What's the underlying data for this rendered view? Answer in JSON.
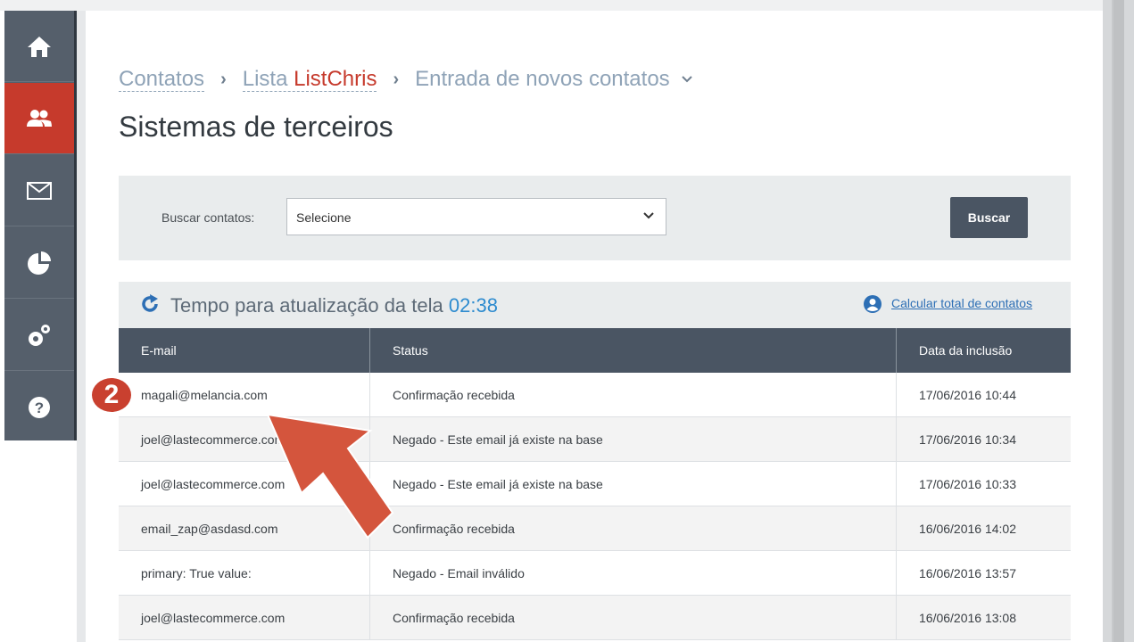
{
  "breadcrumb": {
    "contacts": "Contatos",
    "list_prefix": "Lista",
    "list_name": "ListChris",
    "current": "Entrada de novos contatos",
    "separator": "›",
    "chevron": "⌄"
  },
  "page_title": "Sistemas de terceiros",
  "search": {
    "label": "Buscar contatos:",
    "select_value": "Selecione",
    "button_label": "Buscar"
  },
  "results": {
    "timer_label": "Tempo para atualização da tela",
    "timer_value": "02:38",
    "calc_link": "Calcular total de contatos"
  },
  "table": {
    "headers": [
      "E-mail",
      "Status",
      "Data da inclusão"
    ],
    "rows": [
      [
        "magali@melancia.com",
        "Confirmação recebida",
        "17/06/2016 10:44"
      ],
      [
        "joel@lastecommerce.com",
        "Negado - Este email já existe na base",
        "17/06/2016 10:34"
      ],
      [
        "joel@lastecommerce.com",
        "Negado - Este email já existe na base",
        "17/06/2016 10:33"
      ],
      [
        "email_zap@asdasd.com",
        "Confirmação recebida",
        "16/06/2016 14:02"
      ],
      [
        "primary: True value:",
        "Negado - Email inválido",
        "16/06/2016 13:57"
      ],
      [
        "joel@lastecommerce.com",
        "Confirmação recebida",
        "16/06/2016 13:08"
      ]
    ]
  },
  "annotation": {
    "step_number": "2"
  },
  "sidebar": {
    "items": [
      {
        "icon": "home-icon"
      },
      {
        "icon": "contacts-icon",
        "active": true
      },
      {
        "icon": "mail-icon"
      },
      {
        "icon": "pie-chart-icon"
      },
      {
        "icon": "settings-icon"
      },
      {
        "icon": "help-icon"
      }
    ]
  },
  "colors": {
    "accent_red": "#c63a2c",
    "sidebar": "#555f6b",
    "table_header": "#4a5563",
    "link_blue": "#2d8bcf"
  }
}
